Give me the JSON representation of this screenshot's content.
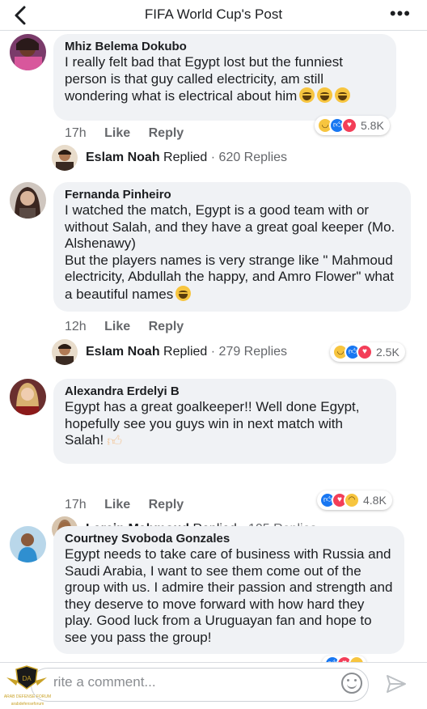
{
  "header": {
    "title": "FIFA World Cup's Post"
  },
  "comments": [
    {
      "name": "Mhiz Belema Dokubo",
      "text": "I really felt bad that Egypt lost but the funniest person is that guy called electricity, am still wondering what is electrical about him",
      "time": "17h",
      "like": "Like",
      "reply": "Reply",
      "reaction_count": "5.8K",
      "reactions": [
        "haha-icon",
        "like-icon",
        "love-icon"
      ],
      "replied_by": "Eslam Noah",
      "replied_label": "Replied",
      "replies": "· 620 Replies"
    },
    {
      "name": "Fernanda Pinheiro",
      "text": "I watched the match, Egypt is a good team with or without Salah, and they have a great goal keeper (Mo. Alshenawy)\nBut the players names is very strange like \" Mahmoud electricity, Abdullah the happy, and Amro Flower\" what a beautiful names",
      "time": "12h",
      "like": "Like",
      "reply": "Reply",
      "reaction_count": "2.5K",
      "reactions": [
        "haha-icon",
        "like-icon",
        "love-icon"
      ],
      "replied_by": "Eslam Noah",
      "replied_label": "Replied",
      "replies": "· 279 Replies"
    },
    {
      "name": "Alexandra Erdelyi B",
      "text": "Egypt has a great goalkeeper!! Well done Egypt, hopefully see you guys win in next match with Salah!",
      "time": "17h",
      "like": "Like",
      "reply": "Reply",
      "reaction_count": "4.8K",
      "reactions": [
        "like-icon",
        "love-icon",
        "sad-icon"
      ],
      "replied_by": "Larein Mahmoud",
      "replied_label": "Replied",
      "replies": "· 105 Replies"
    },
    {
      "name": "Courtney Svoboda Gonzales",
      "text": "Egypt needs to take care of business with Russia and Saudi Arabia, I want to see them come out of the group with us. I admire their passion and strength and they deserve to move forward with how hard they play. Good luck from a Uruguayan fan and hope to see you pass the group!",
      "reactions": [
        "like-icon",
        "love-icon",
        "haha-icon"
      ]
    }
  ],
  "composer": {
    "placeholder": "Write a comment...",
    "visible_text": "rite a comment..."
  },
  "watermark": {
    "line1": "ARAB DEFENSE FORUM",
    "line2": "arabdefenseforum"
  }
}
